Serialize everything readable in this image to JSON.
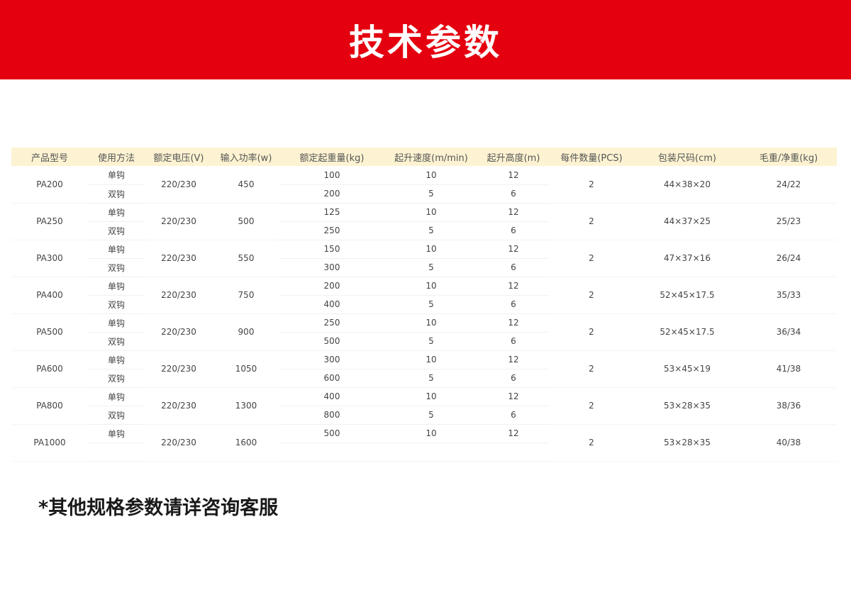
{
  "banner": {
    "title": "技术参数"
  },
  "table": {
    "headers": [
      "产品型号",
      "使用方法",
      "额定电压(V)",
      "输入功率(w)",
      "额定起重量(kg)",
      "起升速度(m/min)",
      "起升高度(m)",
      "每件数量(PCS)",
      "包装尺码(cm)",
      "毛重/净重(kg)"
    ],
    "rows": [
      {
        "model": "PA200",
        "voltage": "220/230",
        "power": "450",
        "qty": "2",
        "pack": "44×38×20",
        "weight": "24/22",
        "subs": [
          {
            "method": "单钩",
            "load": "100",
            "speed": "10",
            "height": "12"
          },
          {
            "method": "双钩",
            "load": "200",
            "speed": "5",
            "height": "6"
          }
        ]
      },
      {
        "model": "PA250",
        "voltage": "220/230",
        "power": "500",
        "qty": "2",
        "pack": "44×37×25",
        "weight": "25/23",
        "subs": [
          {
            "method": "单钩",
            "load": "125",
            "speed": "10",
            "height": "12"
          },
          {
            "method": "双钩",
            "load": "250",
            "speed": "5",
            "height": "6"
          }
        ]
      },
      {
        "model": "PA300",
        "voltage": "220/230",
        "power": "550",
        "qty": "2",
        "pack": "47×37×16",
        "weight": "26/24",
        "subs": [
          {
            "method": "单钩",
            "load": "150",
            "speed": "10",
            "height": "12"
          },
          {
            "method": "双钩",
            "load": "300",
            "speed": "5",
            "height": "6"
          }
        ]
      },
      {
        "model": "PA400",
        "voltage": "220/230",
        "power": "750",
        "qty": "2",
        "pack": "52×45×17.5",
        "weight": "35/33",
        "subs": [
          {
            "method": "单钩",
            "load": "200",
            "speed": "10",
            "height": "12"
          },
          {
            "method": "双钩",
            "load": "400",
            "speed": "5",
            "height": "6"
          }
        ]
      },
      {
        "model": "PA500",
        "voltage": "220/230",
        "power": "900",
        "qty": "2",
        "pack": "52×45×17.5",
        "weight": "36/34",
        "subs": [
          {
            "method": "单钩",
            "load": "250",
            "speed": "10",
            "height": "12"
          },
          {
            "method": "双钩",
            "load": "500",
            "speed": "5",
            "height": "6"
          }
        ]
      },
      {
        "model": "PA600",
        "voltage": "220/230",
        "power": "1050",
        "qty": "2",
        "pack": "53×45×19",
        "weight": "41/38",
        "subs": [
          {
            "method": "单钩",
            "load": "300",
            "speed": "10",
            "height": "12"
          },
          {
            "method": "双钩",
            "load": "600",
            "speed": "5",
            "height": "6"
          }
        ]
      },
      {
        "model": "PA800",
        "voltage": "220/230",
        "power": "1300",
        "qty": "2",
        "pack": "53×28×35",
        "weight": "38/36",
        "subs": [
          {
            "method": "单钩",
            "load": "400",
            "speed": "10",
            "height": "12"
          },
          {
            "method": "双钩",
            "load": "800",
            "speed": "5",
            "height": "6"
          }
        ]
      },
      {
        "model": "PA1000",
        "voltage": "220/230",
        "power": "1600",
        "qty": "2",
        "pack": "53×28×35",
        "weight": "40/38",
        "subs": [
          {
            "method": "单钩",
            "load": "500",
            "speed": "10",
            "height": "12"
          },
          {
            "method": "",
            "load": "",
            "speed": "",
            "height": ""
          }
        ]
      }
    ]
  },
  "footnote": "*其他规格参数请详咨询客服",
  "colors": {
    "banner": "#e4000f",
    "header_bg": "#fdf3d2"
  }
}
